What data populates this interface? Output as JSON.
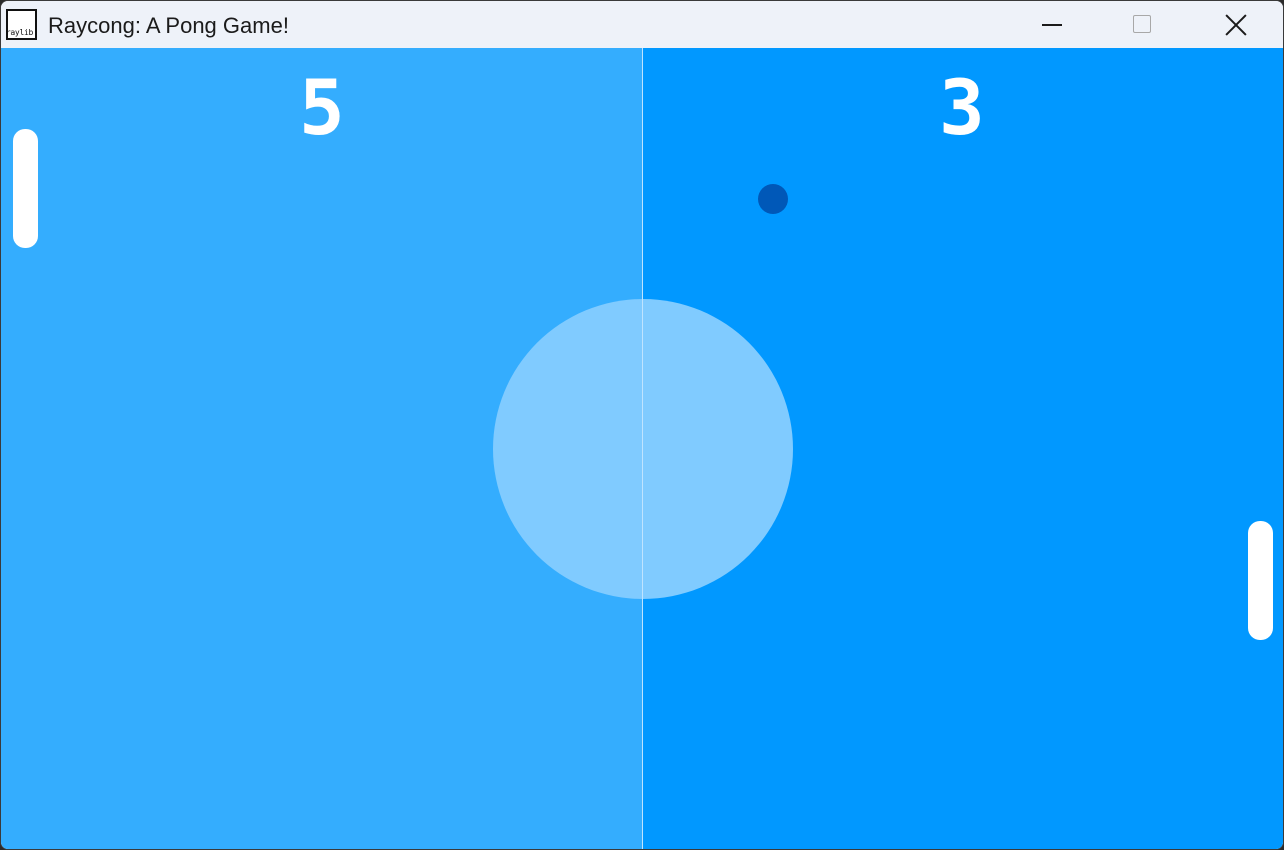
{
  "window": {
    "title": "Raycong: A Pong Game!",
    "icon_label": "raylib",
    "controls": [
      "minimize-icon",
      "maximize-icon",
      "close-icon"
    ]
  },
  "game": {
    "score_left": "5",
    "score_right": "3",
    "colors": {
      "left_half": "#34adfe",
      "right_half": "#0198ff",
      "center_circle": "#80cbff",
      "paddle": "#ffffff",
      "ball": "#0058b8",
      "score": "#ffffff"
    }
  }
}
